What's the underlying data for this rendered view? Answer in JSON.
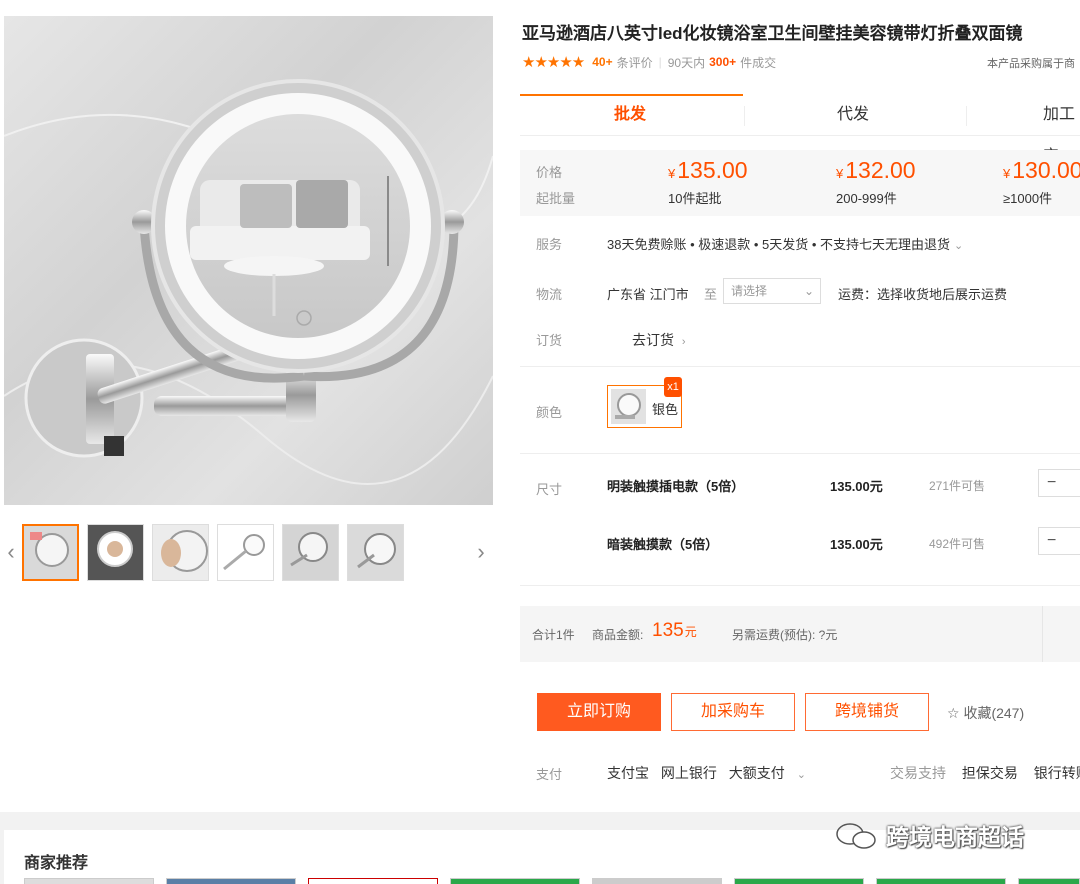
{
  "product": {
    "title": "亚马逊酒店八英寸led化妆镜浴室卫生间壁挂美容镜带灯折叠双面镜",
    "stars": "★★★★★",
    "review_count": "40+",
    "review_label": "条评价",
    "sales_prefix": "90天内",
    "sales_count": "300+",
    "sales_suffix": "件成交",
    "procure_note": "本产品采购属于商"
  },
  "tabs": [
    {
      "label": "批发",
      "active": true
    },
    {
      "label": "代发",
      "active": false
    },
    {
      "label": "加工定",
      "active": false
    }
  ],
  "price_box": {
    "price_label": "价格",
    "moq_label": "起批量",
    "currency": "¥",
    "tiers": [
      {
        "price": "135.00",
        "moq": "10件起批"
      },
      {
        "price": "132.00",
        "moq": "200-999件"
      },
      {
        "price": "130.00",
        "moq": "≥1000件"
      }
    ]
  },
  "service": {
    "label": "服务",
    "text": "38天免费赊账 • 极速退款 • 5天发货 • 不支持七天无理由退货",
    "chevron": "⌄"
  },
  "logistics": {
    "label": "物流",
    "origin": "广东省 江门市",
    "to": "至",
    "select_placeholder": "请选择",
    "select_arrow": "⌄",
    "freight": "运费：选择收货地后展示运费"
  },
  "order": {
    "label": "订货",
    "link": "去订货",
    "chevron": "›"
  },
  "color": {
    "label": "颜色",
    "option": "银色",
    "qty_badge": "x1"
  },
  "size": {
    "label": "尺寸",
    "items": [
      {
        "name": "明装触摸插电款（5倍）",
        "price": "135.00元",
        "stock": "271件可售",
        "minus": "−"
      },
      {
        "name": "暗装触摸款（5倍）",
        "price": "135.00元",
        "stock": "492件可售",
        "minus": "−"
      }
    ]
  },
  "summary": {
    "count": "合计1件",
    "amount_label": "商品金额:",
    "amount": "135",
    "amount_unit": "元",
    "freight": "另需运费(预估): ?元"
  },
  "actions": {
    "buy_now": "立即订购",
    "add_cart": "加采购车",
    "cross_border": "跨境铺货",
    "favorite_icon": "☆",
    "favorite": "收藏(247)"
  },
  "payment": {
    "label": "支付",
    "methods": [
      "支付宝",
      "网上银行"
    ],
    "large": "大额支付",
    "chevron": "⌄",
    "trade_support_label": "交易支持",
    "trade_support_items": [
      "担保交易",
      "银行转账"
    ]
  },
  "recommend": {
    "title": "商家推荐"
  },
  "gallery": {
    "prev": "‹",
    "next": "›"
  },
  "watermark": {
    "text": "跨境电商超话"
  },
  "colors": {
    "accent": "#ff5000",
    "tab_underline": "#ff7300"
  }
}
